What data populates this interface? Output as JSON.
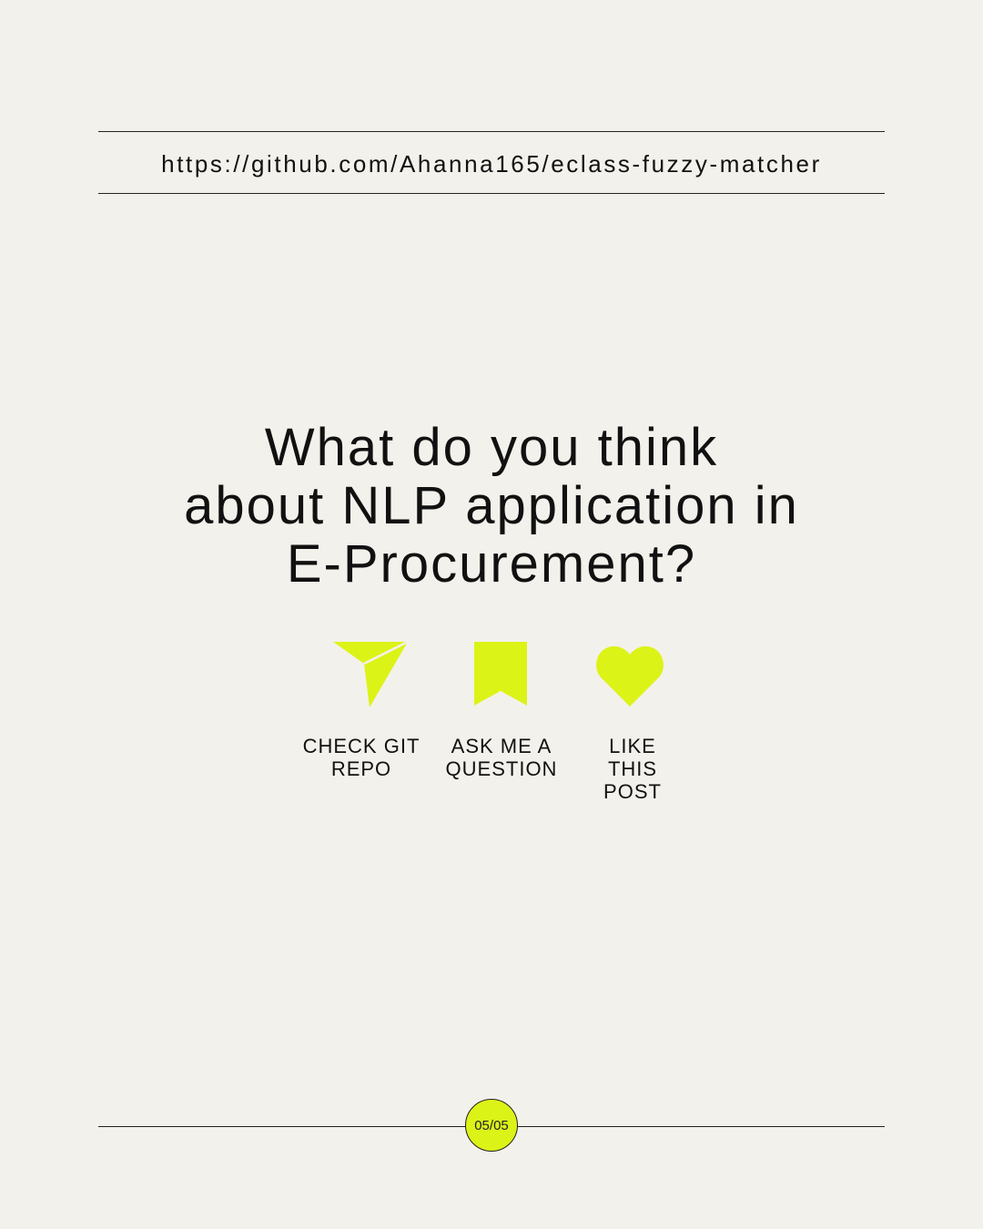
{
  "url": "https://github.com/Ahanna165/eclass-fuzzy-matcher",
  "headline": {
    "line1": "What do you think",
    "line2": "about NLP application in",
    "line3": "E-Procurement?"
  },
  "actions": [
    {
      "icon": "paper-plane-icon",
      "lines": [
        "CHECK GIT",
        "REPO"
      ]
    },
    {
      "icon": "bookmark-icon",
      "lines": [
        "ASK ME A",
        "QUESTION"
      ]
    },
    {
      "icon": "heart-icon",
      "lines": [
        "LIKE",
        "THIS",
        "POST"
      ]
    }
  ],
  "page_indicator": "05/05",
  "colors": {
    "background": "#f3f1eb",
    "accent": "#dcf318",
    "text": "#111111"
  }
}
